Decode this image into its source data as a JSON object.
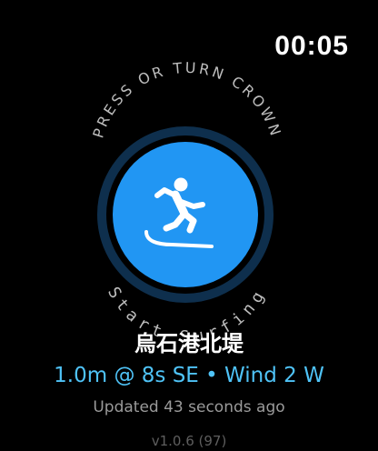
{
  "status_bar": {
    "time": "00:05"
  },
  "dial": {
    "top_hint": "PRESS OR TURN CROWN",
    "bottom_label": "Start Surfing",
    "button_icon": "surfer-icon",
    "button_color": "#2196f3",
    "ring_color": "#0e2f4d"
  },
  "spot": {
    "name": "烏石港北堤",
    "conditions": "1.0m @ 8s SE • Wind 2 W",
    "updated": "Updated 43 seconds ago"
  },
  "footer": {
    "version": "v1.0.6 (97)"
  },
  "colors": {
    "accent": "#4fc3f7",
    "muted_text": "#9a9a9a",
    "version_text": "#5e5e5e"
  }
}
